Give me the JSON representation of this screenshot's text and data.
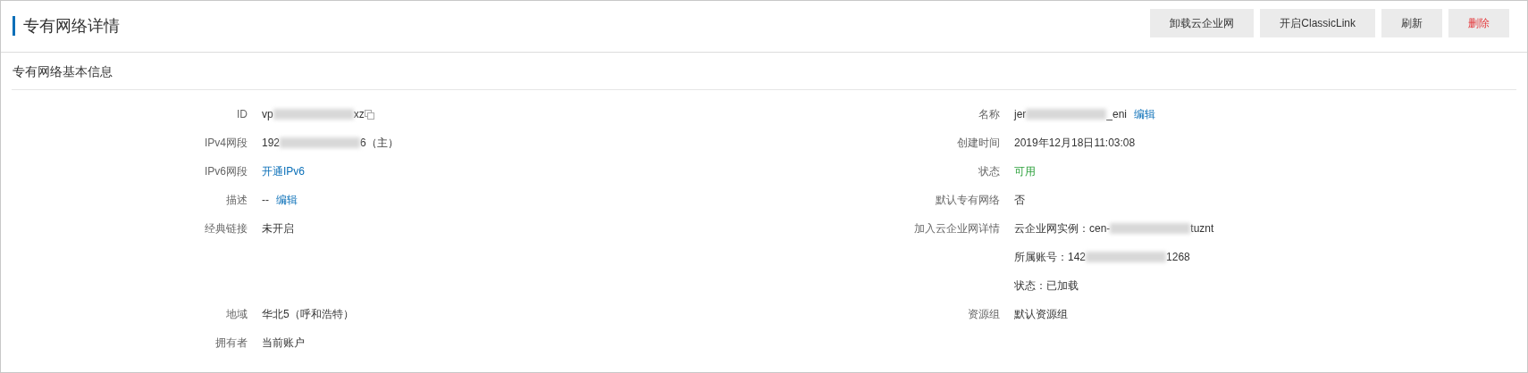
{
  "header": {
    "title": "专有网络详情",
    "buttons": [
      {
        "label": "卸载云企业网",
        "kind": "normal"
      },
      {
        "label": "开启ClassicLink",
        "kind": "normal"
      },
      {
        "label": "刷新",
        "kind": "normal"
      },
      {
        "label": "删除",
        "kind": "danger"
      }
    ]
  },
  "section": {
    "title": "专有网络基本信息",
    "rows": [
      {
        "left": {
          "label": "ID",
          "lines": [
            [
              {
                "kind": "text",
                "text": "vp"
              },
              {
                "kind": "blur"
              },
              {
                "kind": "text",
                "text": "xz"
              },
              {
                "kind": "copy"
              }
            ]
          ]
        },
        "right": {
          "label": "名称",
          "lines": [
            [
              {
                "kind": "text",
                "text": "jer"
              },
              {
                "kind": "blur"
              },
              {
                "kind": "text",
                "text": "_eni"
              },
              {
                "kind": "link",
                "text": "编辑"
              }
            ]
          ]
        }
      },
      {
        "left": {
          "label": "IPv4网段",
          "lines": [
            [
              {
                "kind": "text",
                "text": "192"
              },
              {
                "kind": "blur"
              },
              {
                "kind": "text",
                "text": "6（主）"
              }
            ]
          ]
        },
        "right": {
          "label": "创建时间",
          "lines": [
            [
              {
                "kind": "text",
                "text": "2019年12月18日11:03:08"
              }
            ]
          ]
        }
      },
      {
        "left": {
          "label": "IPv6网段",
          "lines": [
            [
              {
                "kind": "link",
                "text": "开通IPv6"
              }
            ]
          ]
        },
        "right": {
          "label": "状态",
          "lines": [
            [
              {
                "kind": "success",
                "text": "可用"
              }
            ]
          ]
        }
      },
      {
        "left": {
          "label": "描述",
          "lines": [
            [
              {
                "kind": "text",
                "text": "--"
              },
              {
                "kind": "link",
                "text": "编辑"
              }
            ]
          ]
        },
        "right": {
          "label": "默认专有网络",
          "lines": [
            [
              {
                "kind": "text",
                "text": "否"
              }
            ]
          ]
        }
      },
      {
        "left": {
          "label": "经典链接",
          "lines": [
            [
              {
                "kind": "text",
                "text": "未开启"
              }
            ]
          ]
        },
        "right": {
          "label": "加入云企业网详情",
          "lines": [
            [
              {
                "kind": "text",
                "text": "云企业网实例：cen-"
              },
              {
                "kind": "blur"
              },
              {
                "kind": "text",
                "text": "tuznt"
              }
            ],
            [
              {
                "kind": "text",
                "text": "所属账号：142"
              },
              {
                "kind": "blur"
              },
              {
                "kind": "text",
                "text": "1268"
              }
            ],
            [
              {
                "kind": "text",
                "text": "状态：已加载"
              }
            ]
          ]
        }
      },
      {
        "left": {
          "label": "地域",
          "lines": [
            [
              {
                "kind": "text",
                "text": "华北5（呼和浩特）"
              }
            ]
          ]
        },
        "right": {
          "label": "资源组",
          "lines": [
            [
              {
                "kind": "text",
                "text": "默认资源组"
              }
            ]
          ]
        }
      },
      {
        "left": {
          "label": "拥有者",
          "lines": [
            [
              {
                "kind": "text",
                "text": "当前账户"
              }
            ]
          ]
        }
      }
    ]
  }
}
